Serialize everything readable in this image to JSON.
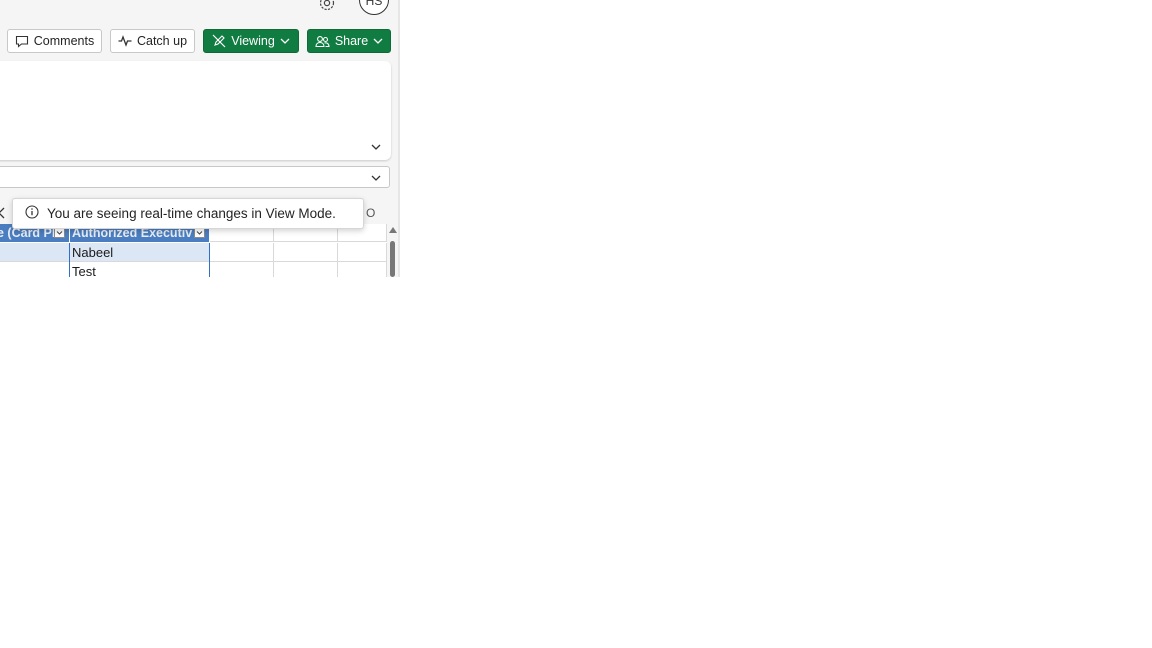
{
  "header": {
    "avatar_initials": "HS"
  },
  "toolbar": {
    "comments_label": "Comments",
    "catchup_label": "Catch up",
    "viewing_label": "Viewing",
    "share_label": "Share"
  },
  "notification": {
    "message": "You are seeing real-time changes in View Mode."
  },
  "grid": {
    "column_letter_visible": "O",
    "headers": [
      "e (Card Pl",
      "Authorized Executiv"
    ],
    "rows": [
      {
        "authorized_executive": "Nabeel"
      },
      {
        "authorized_executive": "Test"
      }
    ]
  },
  "colors": {
    "accent_green": "#107c41",
    "table_header_blue": "#4a7ec0",
    "selection_fill": "#dce7f5"
  },
  "icons": [
    "gear-icon",
    "comment-icon",
    "activity-icon",
    "pencil-off-icon",
    "share-people-icon",
    "chevron-down-icon",
    "info-icon",
    "chevron-left-icon",
    "filter-dropdown-icon"
  ]
}
